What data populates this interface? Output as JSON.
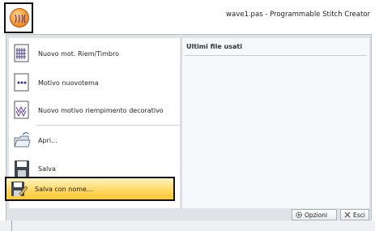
{
  "window": {
    "title": "wave1.pas - Programmable Stitch Creator"
  },
  "menu": {
    "items": [
      {
        "label": "Nuovo mot. Riem/Timbro",
        "icon": "new-fill-stamp-icon"
      },
      {
        "label": "Motivo nuovotema",
        "icon": "new-motif-icon"
      },
      {
        "label": "Nuovo motivo riempimento decorativo",
        "icon": "new-decorative-fill-icon"
      },
      {
        "label": "Apri...",
        "icon": "open-folder-icon"
      },
      {
        "label": "Salva",
        "icon": "save-icon"
      },
      {
        "label": "Salva con nome...",
        "icon": "save-as-icon"
      }
    ],
    "recent_title": "Ultimi file usati",
    "options_label": "Opzioni",
    "exit_label": "Esci"
  }
}
